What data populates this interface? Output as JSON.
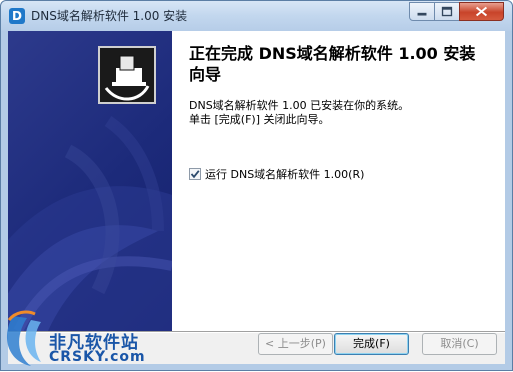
{
  "window": {
    "app_icon_letter": "D",
    "title": "DNS域名解析软件 1.00 安装"
  },
  "controls": {
    "minimize_icon": "minimize-icon",
    "maximize_icon": "maximize-icon",
    "close_icon": "close-icon"
  },
  "wizard": {
    "heading": "正在完成 DNS域名解析软件 1.00 安装向导",
    "message_line1": "DNS域名解析软件 1.00 已安装在你的系统。",
    "message_line2": "单击 [完成(F)] 关闭此向导。",
    "run_checkbox": {
      "label": "运行 DNS域名解析软件 1.00(R)",
      "checked": true
    }
  },
  "buttons": {
    "back": "< 上一步(P)",
    "finish": "完成(F)",
    "cancel": "取消(C)"
  },
  "watermark": {
    "name": "非凡软件站",
    "domain": "CRSKY.com"
  },
  "colors": {
    "sidebar": "#1c2a7a",
    "title_gradient_top": "#d7e6f6",
    "close_button": "#c8442a",
    "watermark_text": "#1a56a8"
  }
}
